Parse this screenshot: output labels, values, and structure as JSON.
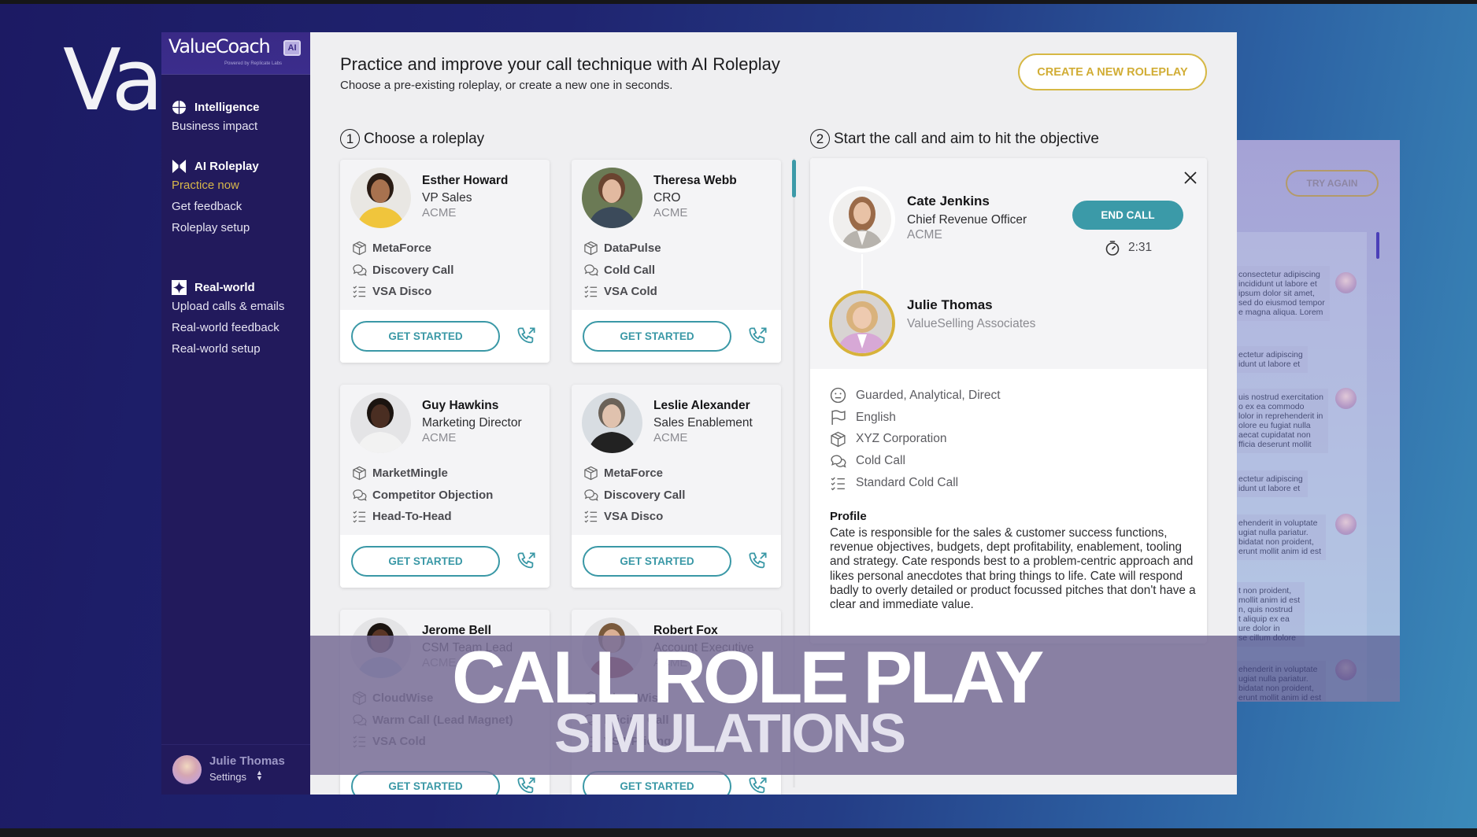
{
  "background": {
    "brand_fragment": "Val",
    "side_panel": {
      "try_again_label": "TRY AGAIN",
      "messages": [
        "consectetur adipiscing\nincididunt ut labore et\nipsum dolor sit amet,\nsed do eiusmod tempor\ne magna aliqua. Lorem",
        "ectetur adipiscing\nidunt ut labore et",
        "uis nostrud exercitation\no ex ea commodo\nlolor in reprehenderit in\nolore eu fugiat nulla\naecat cupidatat non\nfficia deserunt mollit",
        "ectetur adipiscing\nidunt ut labore et",
        "ehenderit in voluptate\nugiat nulla pariatur.\nbidatat non proident,\nerunt mollit anim id est",
        "t non proident,\nmollit anim id est\nn, quis nostrud\nt aliquip ex ea\nure dolor in\nse cillum dolore",
        "ehenderit in voluptate\nugiat nulla pariatur.\nbidatat non proident,\nerunt mollit anim id est"
      ]
    }
  },
  "sidebar": {
    "logo": "ValueCoach",
    "logo_badge": "AI",
    "logo_sub": "Powered by Replicate Labs",
    "groups": [
      {
        "label": "Intelligence",
        "icon": "globe-icon",
        "items": [
          {
            "label": "Business impact",
            "active": false
          }
        ]
      },
      {
        "label": "AI Roleplay",
        "icon": "roleplay-icon",
        "items": [
          {
            "label": "Practice now",
            "active": true
          },
          {
            "label": "Get feedback",
            "active": false
          },
          {
            "label": "Roleplay setup",
            "active": false
          }
        ]
      },
      {
        "label": "Real-world",
        "icon": "sparkle-icon",
        "items": [
          {
            "label": "Upload calls & emails",
            "active": false
          },
          {
            "label": "Real-world feedback",
            "active": false
          },
          {
            "label": "Real-world setup",
            "active": false
          }
        ]
      }
    ],
    "user": {
      "name": "Julie Thomas",
      "settings_label": "Settings"
    }
  },
  "main": {
    "title": "Practice and improve your call technique with AI Roleplay",
    "subtitle": "Choose a pre-existing roleplay, or create a new one in seconds.",
    "create_button": "CREATE A NEW ROLEPLAY",
    "step1": {
      "num": "1",
      "label": "Choose a roleplay"
    },
    "step2": {
      "num": "2",
      "label": "Start the call and aim to hit the objective"
    },
    "get_started_label": "GET STARTED",
    "roleplays": [
      {
        "name": "Esther Howard",
        "role": "VP Sales",
        "company": "ACME",
        "product": "MetaForce",
        "call_type": "Discovery Call",
        "methodology": "VSA Disco"
      },
      {
        "name": "Theresa Webb",
        "role": "CRO",
        "company": "ACME",
        "product": "DataPulse",
        "call_type": "Cold Call",
        "methodology": "VSA Cold"
      },
      {
        "name": "Guy Hawkins",
        "role": "Marketing Director",
        "company": "ACME",
        "product": "MarketMingle",
        "call_type": "Competitor Objection",
        "methodology": "Head-To-Head"
      },
      {
        "name": "Leslie Alexander",
        "role": "Sales Enablement",
        "company": "ACME",
        "product": "MetaForce",
        "call_type": "Discovery Call",
        "methodology": "VSA Disco"
      },
      {
        "name": "Jerome Bell",
        "role": "CSM Team Lead",
        "company": "ACME",
        "product": "CloudWise",
        "call_type": "Warm Call (Lead Magnet)",
        "methodology": "VSA Cold"
      },
      {
        "name": "Robert Fox",
        "role": "Account Executive",
        "company": "ACME",
        "product": "CloudWise",
        "call_type": "Pricing Call",
        "methodology": "VSA Pricing"
      }
    ]
  },
  "call": {
    "prospect": {
      "name": "Cate Jenkins",
      "title": "Chief Revenue Officer",
      "company": "ACME"
    },
    "rep": {
      "name": "Julie Thomas",
      "company": "ValueSelling Associates"
    },
    "end_call_label": "END CALL",
    "timer": "2:31",
    "attributes": [
      {
        "icon": "face-icon",
        "text": "Guarded, Analytical, Direct"
      },
      {
        "icon": "flag-icon",
        "text": "English"
      },
      {
        "icon": "box-icon",
        "text": "XYZ Corporation"
      },
      {
        "icon": "chat-icon",
        "text": "Cold Call"
      },
      {
        "icon": "checklist-icon",
        "text": "Standard Cold Call"
      }
    ],
    "profile_title": "Profile",
    "profile_text": "Cate is responsible for the sales & customer success functions, revenue objectives, budgets, dept profitability, enablement, tooling and strategy. Cate responds best to a problem-centric approach and likes personal anecdotes that bring things to life. Cate will respond badly to overly detailed or product focussed pitches that don't have a clear and immediate value."
  },
  "overlay": {
    "line1": "CALL ROLE PLAY",
    "line2": "SIMULATIONS"
  },
  "colors": {
    "accent_teal": "#3b9aa8",
    "accent_gold": "#d6b845",
    "sidebar_bg": "#221a5c",
    "active_nav": "#d7b64a"
  }
}
